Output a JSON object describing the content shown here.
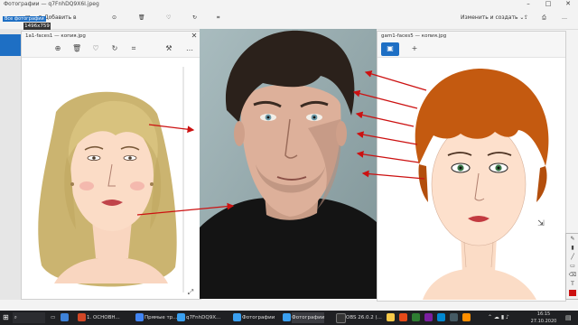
{
  "bg_window": {
    "title": "Фотографии — q7FnhDQ9X6I.jpeg",
    "add_label": "Добавить в",
    "edit_label": "Изменить и создать",
    "all_photos": "Все фотографии",
    "size_badge": "1496x759"
  },
  "left_window": {
    "title": "1a1-faces1 — копия.jpg"
  },
  "right_window": {
    "title": "gam1-faces5 — копия.jpg"
  },
  "taskbar": {
    "items": [
      "1. ОСНОВН...",
      "Прямые тр...",
      "q7FnhDQ9X...",
      "Фотографии",
      "Фотографии",
      "OBS 26.0.2 (..."
    ],
    "time": "16:15",
    "date": "27.10.2020"
  },
  "colors": {
    "accent": "#1e6fc4",
    "arrow": "#cc1111",
    "taskbar": "#1f2023"
  }
}
